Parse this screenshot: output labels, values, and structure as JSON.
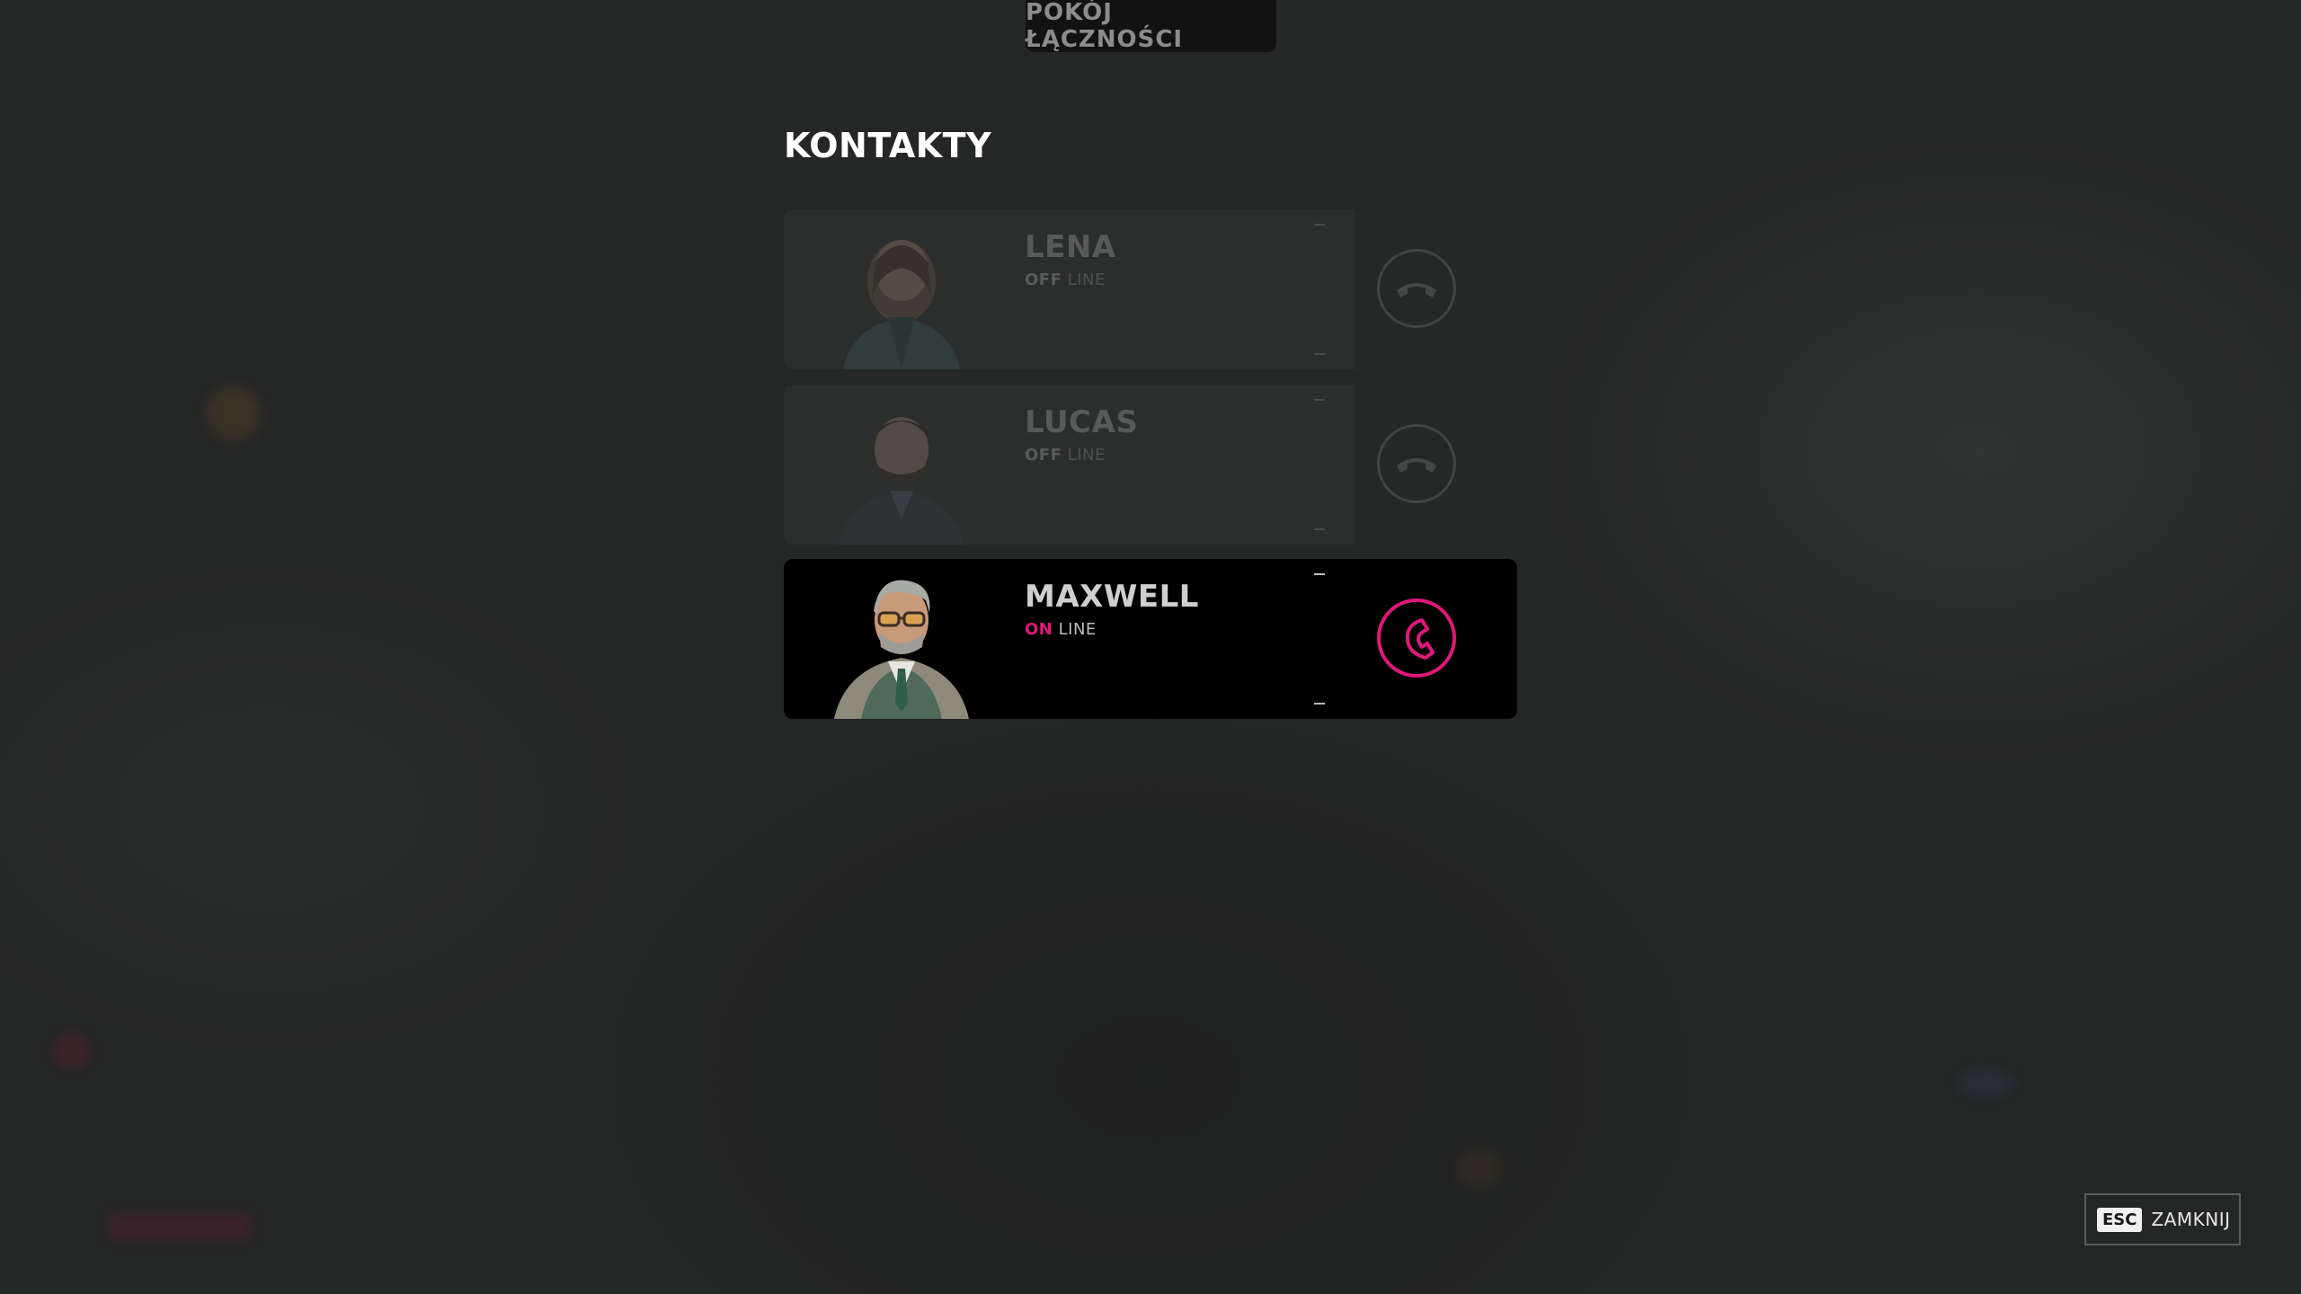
{
  "top_tab": {
    "label": "POKÓJ ŁĄCZNOŚCI"
  },
  "heading": "KONTAKTY",
  "contacts": [
    {
      "name": "LENA",
      "status": "OFF",
      "status_suffix": "LINE",
      "online": false,
      "action_icon": "hang-up-icon"
    },
    {
      "name": "LUCAS",
      "status": "OFF",
      "status_suffix": "LINE",
      "online": false,
      "action_icon": "hang-up-icon"
    },
    {
      "name": "MAXWELL",
      "status": "ON",
      "status_suffix": "LINE",
      "online": true,
      "action_icon": "phone-icon"
    }
  ],
  "close": {
    "key": "ESC",
    "label": "ZAMKNIJ"
  },
  "colors": {
    "accent": "#e0187a",
    "background": "#262727",
    "card_off": "#2c2d2d",
    "card_on": "#000000"
  }
}
